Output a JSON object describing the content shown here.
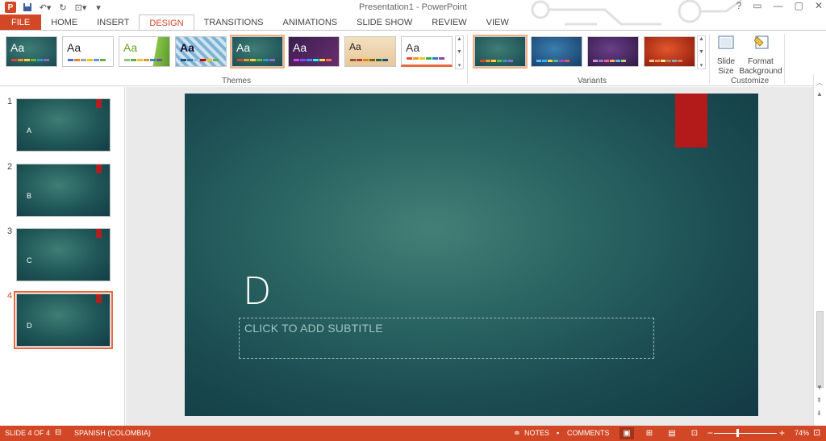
{
  "window": {
    "title": "Presentation1 - PowerPoint",
    "help": "?",
    "controls": [
      "▭",
      "—",
      "▢",
      "✕"
    ]
  },
  "tabs": [
    "FILE",
    "HOME",
    "INSERT",
    "DESIGN",
    "TRANSITIONS",
    "ANIMATIONS",
    "SLIDE SHOW",
    "REVIEW",
    "VIEW"
  ],
  "active_tab": "DESIGN",
  "ribbon": {
    "themes_label": "Themes",
    "variants_label": "Variants",
    "customize_label": "Customize",
    "theme_sample": "Aa",
    "slide_size_label": "Slide Size",
    "format_background_label": "Format Background"
  },
  "slides": [
    {
      "number": "1",
      "label": "A"
    },
    {
      "number": "2",
      "label": "B"
    },
    {
      "number": "3",
      "label": "C"
    },
    {
      "number": "4",
      "label": "D"
    }
  ],
  "current_slide": {
    "title": "D",
    "subtitle_placeholder": "CLICK TO ADD SUBTITLE"
  },
  "status": {
    "slide_info": "SLIDE 4 OF 4",
    "language": "SPANISH (COLOMBIA)",
    "notes": "NOTES",
    "comments": "COMMENTS",
    "zoom_minus": "−",
    "zoom_plus": "+",
    "zoom": "74%",
    "zoom_fraction": 0.37
  },
  "colors": {
    "accent": "#d24726",
    "slide_flag": "#b31a1a",
    "slide_bg": "#1f5656"
  }
}
